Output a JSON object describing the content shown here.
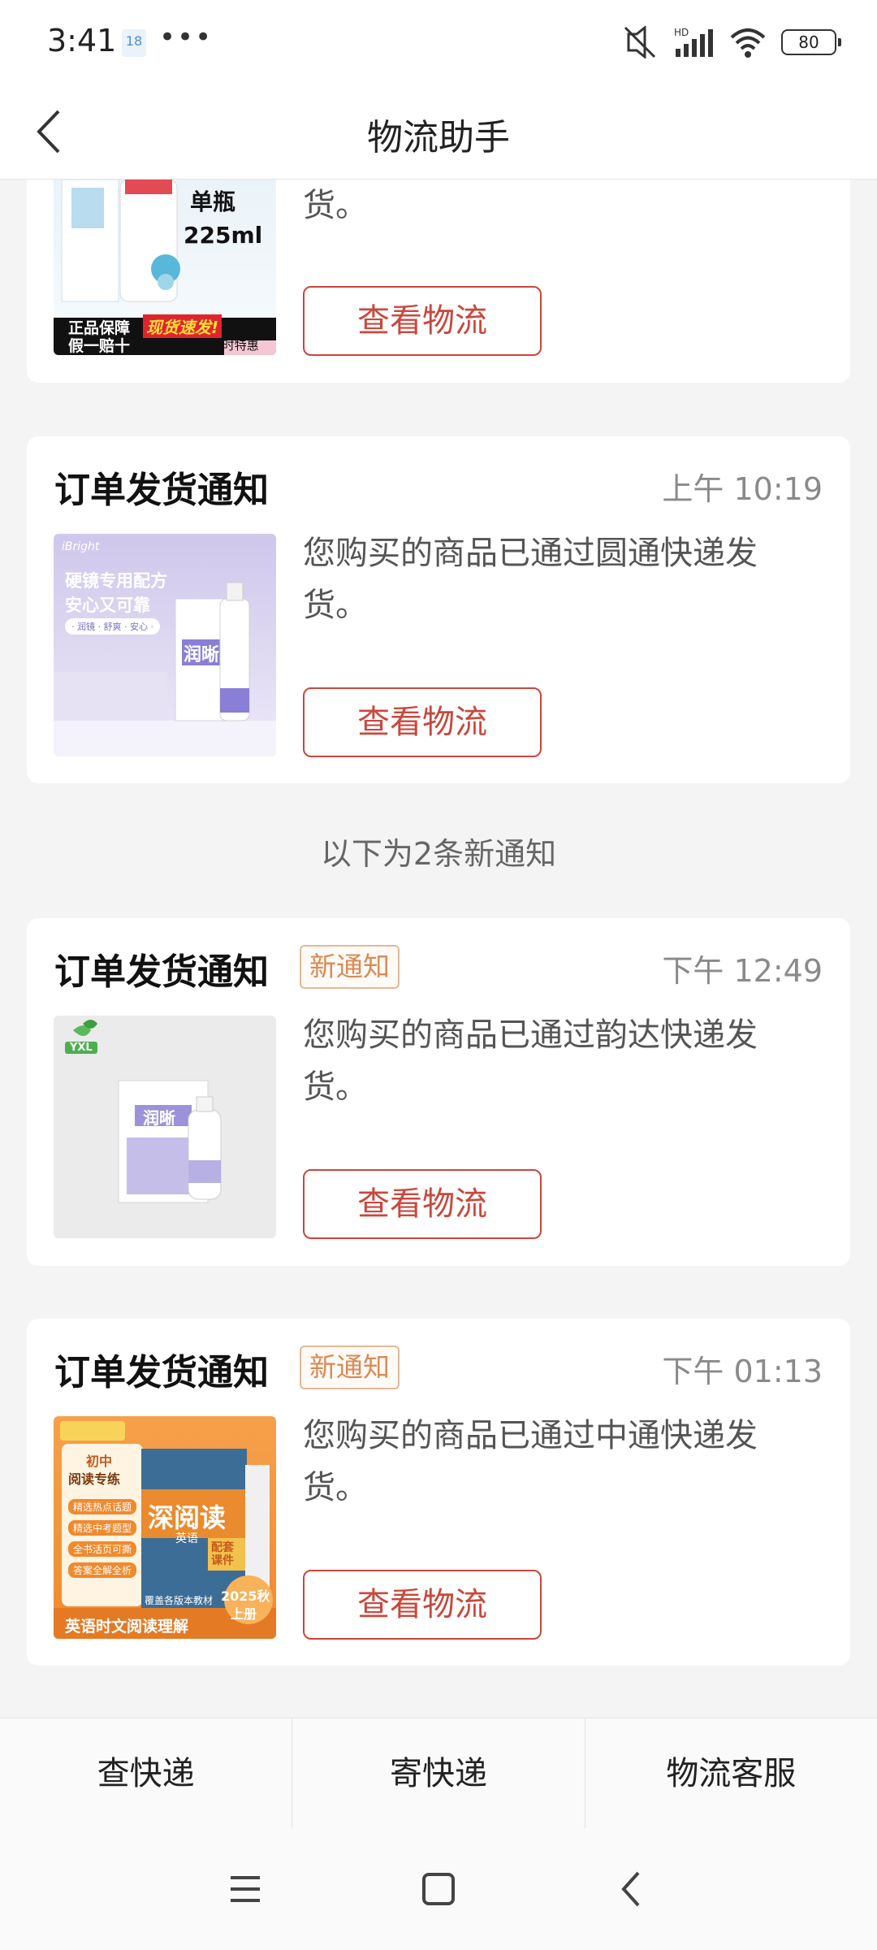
{
  "status": {
    "time": "3:41",
    "calendar": "18",
    "dots": "•••",
    "battery": "80"
  },
  "header": {
    "title": "物流助手"
  },
  "cards": [
    {
      "title": "",
      "time": "",
      "message": "货。",
      "button": "查看物流",
      "thumb_text": {
        "line1": "单瓶",
        "line2": "225ml",
        "tag1": "正品保障",
        "tag2": "假一赔十",
        "tag3": "现货速发!",
        "tag4": "院线同款 限时特惠"
      }
    },
    {
      "title": "订单发货通知",
      "time": "上午 10:19",
      "message": "您购买的商品已通过圆通快递发货。",
      "button": "查看物流",
      "thumb_text": {
        "brand": "iBright",
        "line1": "硬镜专用配方",
        "line2": "安心又可靠",
        "pill": "· 润镜 · 舒爽 · 安心 ·",
        "product": "润晰"
      }
    },
    {
      "title": "订单发货通知",
      "badge": "新通知",
      "time": "下午 12:49",
      "message": "您购买的商品已通过韵达快递发货。",
      "button": "查看物流",
      "thumb_text": {
        "logo": "YXL",
        "product": "润晰"
      }
    },
    {
      "title": "订单发货通知",
      "badge": "新通知",
      "time": "下午 01:13",
      "message": "您购买的商品已通过中通快递发货。",
      "button": "查看物流",
      "thumb_text": {
        "tag1": "初中",
        "tag2": "阅读专练",
        "book": "深阅读",
        "sub": "英语",
        "bullets": [
          "精选热点话题",
          "精选中考题型",
          "全书活页可撕",
          "答案全解全析"
        ],
        "badge": "配套课件",
        "year": "2025秋",
        "volume": "上册",
        "bottom": "英语时文阅读理解",
        "note": "覆盖各版本教材"
      }
    }
  ],
  "divider": "以下为2条新通知",
  "bottom_tabs": [
    "查快递",
    "寄快递",
    "物流客服"
  ]
}
